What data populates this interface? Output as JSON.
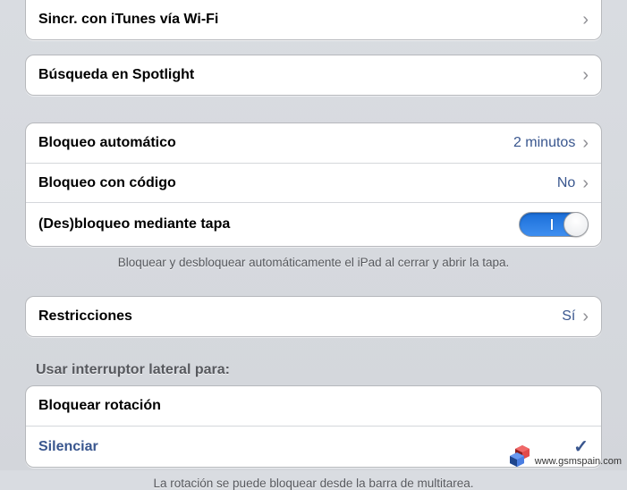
{
  "rows": {
    "itunes_wifi": "Sincr. con iTunes vía Wi-Fi",
    "spotlight": "Búsqueda en Spotlight",
    "auto_lock": {
      "label": "Bloqueo automático",
      "value": "2 minutos"
    },
    "passcode": {
      "label": "Bloqueo con código",
      "value": "No"
    },
    "cover_lock": "(Des)bloqueo mediante tapa",
    "restrictions": {
      "label": "Restricciones",
      "value": "Sí"
    }
  },
  "captions": {
    "cover_note": "Bloquear y desbloquear automáticamente el iPad al cerrar y abrir la tapa.",
    "rotation_note": "La rotación se puede bloquear desde la barra de multitarea."
  },
  "side_switch": {
    "header": "Usar interruptor lateral para:",
    "lock_rotation": "Bloquear rotación",
    "mute": "Silenciar"
  },
  "watermark": "www.gsmspain.com"
}
